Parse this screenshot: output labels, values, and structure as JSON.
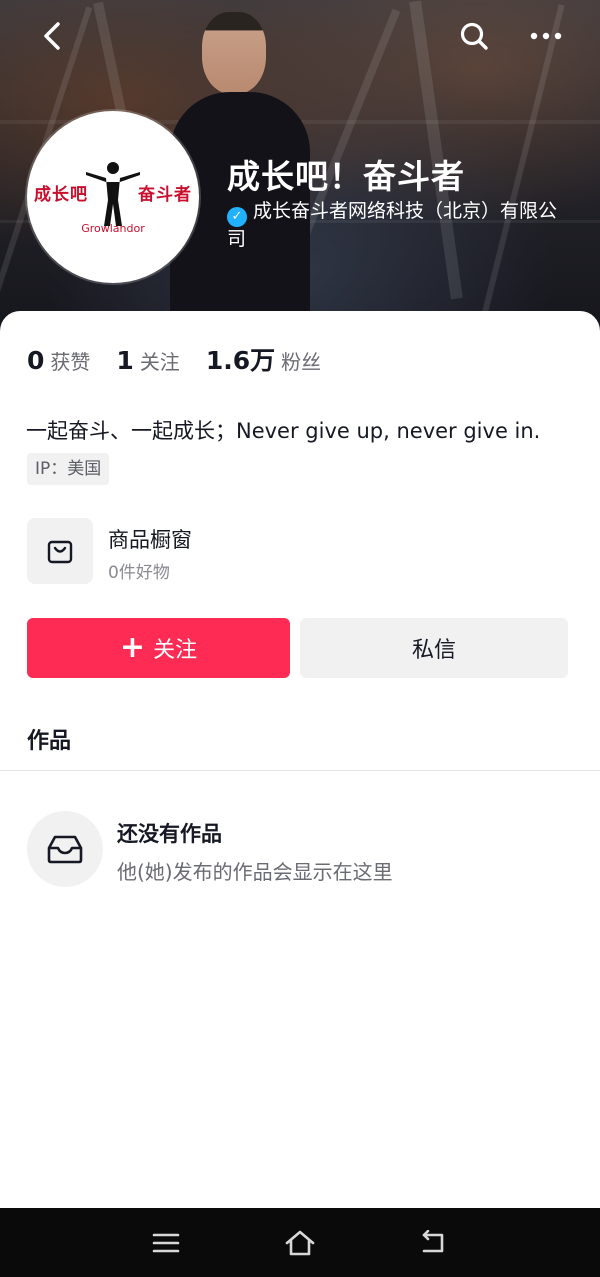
{
  "header": {
    "back_icon": "chevron-left-icon",
    "search_icon": "search-icon",
    "more_icon": "more-dots-icon",
    "avatar_logo_text": "成长吧奋斗者",
    "avatar_logo_en": "Growlandor"
  },
  "profile": {
    "name": "成长吧！奋斗者",
    "verified_org": "成长奋斗者网络科技（北京）有限公司",
    "stats": [
      {
        "value": "0",
        "label": "获赞"
      },
      {
        "value": "1",
        "label": "关注"
      },
      {
        "value": "1.6万",
        "label": "粉丝"
      }
    ],
    "bio": "一起奋斗、一起成长；Never give up, never give in.",
    "ip": "IP：美国"
  },
  "shop": {
    "title": "商品橱窗",
    "subtitle": "0件好物"
  },
  "actions": {
    "follow_label": "关注",
    "message_label": "私信"
  },
  "works": {
    "tab_label": "作品",
    "empty_title": "还没有作品",
    "empty_subtitle": "他(她)发布的作品会显示在这里"
  },
  "colors": {
    "accent": "#fe2c55",
    "verify_badge": "#20b1ff",
    "muted_bg": "#f1f1f2"
  }
}
